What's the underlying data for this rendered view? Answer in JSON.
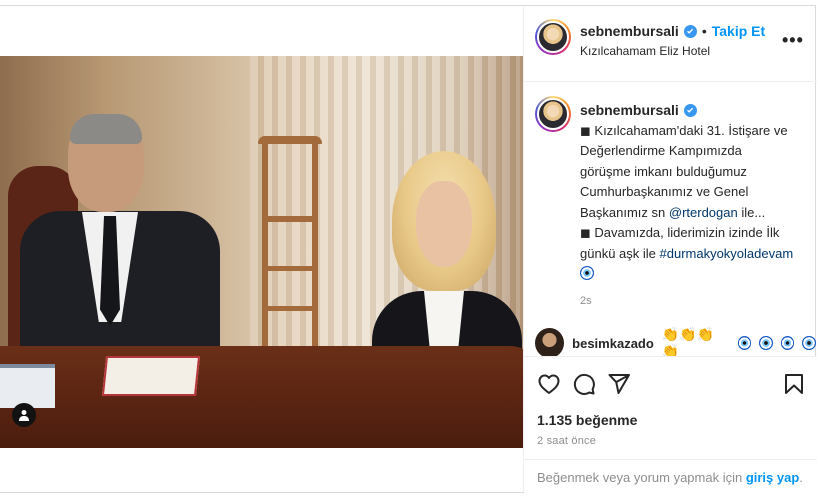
{
  "post": {
    "username": "sebnembursali",
    "follow_label": "Takip Et",
    "separator": "•",
    "location": "Kızılcahamam Eliz Hotel",
    "more_label": "•••"
  },
  "caption": {
    "username": "sebnembursali",
    "lines": [
      "◼ Kızılcahamam'daki 31. İstişare ve",
      "Değerlendirme Kampımızda",
      "görüşme imkanı bulduğumuz",
      "Cumhurbaşkanımız ve Genel"
    ],
    "line5_prefix": "Başkanımız sn ",
    "mention": "@rterdogan",
    "line5_suffix": " ile...",
    "line6": "◼ Davamızda, liderimizin izinde İlk",
    "line7_prefix": "günkü aşk ile ",
    "hashtag": "#durmakyokyoladevam",
    "time": "2s"
  },
  "comment": {
    "username": "besimkazado",
    "claps": "👏👏👏👏"
  },
  "actions": {
    "likes": "1.135 beğenme",
    "ago": "2 saat önce",
    "login_prompt": "Beğenmek veya yorum yapmak için ",
    "login_link": "giriş yap",
    "login_suffix": "."
  },
  "icons": {
    "like": "heart-icon",
    "comment": "comment-icon",
    "share": "share-icon",
    "save": "bookmark-icon",
    "verified": "verified-badge-icon",
    "user_tag": "user-tag-icon"
  },
  "colors": {
    "link_blue": "#0095f6",
    "mention_blue": "#00376b",
    "muted": "#8e8e8e",
    "verified": "#3897f0"
  }
}
